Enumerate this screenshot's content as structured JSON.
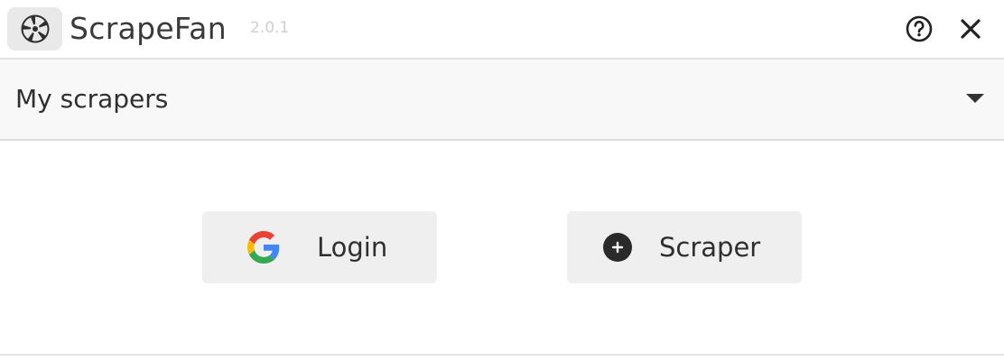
{
  "app": {
    "name": "ScrapeFan",
    "version": "2.0.1",
    "logo_icon": "aperture-icon"
  },
  "titlebar": {
    "help_icon": "help-circle-icon",
    "close_icon": "close-icon"
  },
  "selector": {
    "label": "My scrapers",
    "caret_icon": "caret-down-icon"
  },
  "actions": {
    "login": {
      "label": "Login",
      "icon": "google-icon"
    },
    "scraper": {
      "label": "Scraper",
      "icon": "add-circle-icon"
    }
  },
  "colors": {
    "button_bg": "#efefef",
    "text": "#2f2f2f",
    "version_text": "#cfcfcf",
    "google_blue": "#4285F4",
    "google_red": "#EA4335",
    "google_yellow": "#FBBC05",
    "google_green": "#34A853"
  }
}
